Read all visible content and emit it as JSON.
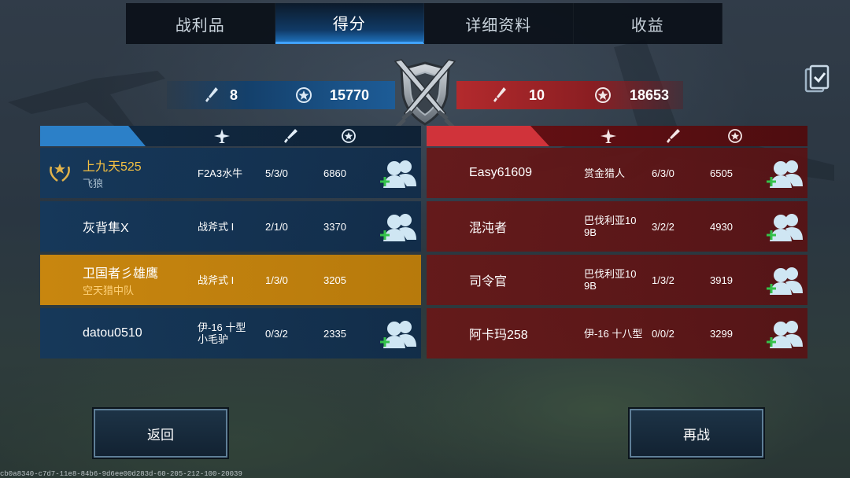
{
  "tabs": [
    {
      "label": "战利品",
      "active": false
    },
    {
      "label": "得分",
      "active": true
    },
    {
      "label": "详细资料",
      "active": false
    },
    {
      "label": "收益",
      "active": false
    }
  ],
  "score_header": {
    "blue_kills": "8",
    "blue_points": "15770",
    "red_kills": "10",
    "red_points": "18653"
  },
  "colors": {
    "blue_team": "#1d5c97",
    "red_team": "#b32a2d",
    "highlight": "#c8860f",
    "name_gold": "#f5c042",
    "add_friend_green": "#34c24a"
  },
  "blue_team": [
    {
      "name": "上九天525",
      "sub": "飞狼",
      "aircraft": "F2A3水牛",
      "kda": "5/3/0",
      "score": "6860",
      "add_friend": true,
      "badge": "laurel-badge-icon"
    },
    {
      "name": "灰背隼X",
      "sub": "",
      "aircraft": "战斧式 I",
      "kda": "2/1/0",
      "score": "3370",
      "add_friend": true
    },
    {
      "name": "卫国者彡雄鹰",
      "sub": "空天猎中队",
      "aircraft": "战斧式 I",
      "kda": "1/3/0",
      "score": "3205",
      "add_friend": false,
      "highlight": true
    },
    {
      "name": "datou0510",
      "sub": "",
      "aircraft": "伊-16 十型\n小毛驴",
      "kda": "0/3/2",
      "score": "2335",
      "add_friend": true
    }
  ],
  "red_team": [
    {
      "name": "Easy61609",
      "sub": "",
      "aircraft": "赏金猎人",
      "kda": "6/3/0",
      "score": "6505",
      "add_friend": true
    },
    {
      "name": "混沌者",
      "sub": "",
      "aircraft": "巴伐利亚10\n9B",
      "kda": "3/2/2",
      "score": "4930",
      "add_friend": true
    },
    {
      "name": "司令官",
      "sub": "",
      "aircraft": "巴伐利亚10\n9B",
      "kda": "1/3/2",
      "score": "3919",
      "add_friend": true
    },
    {
      "name": "阿卡玛258",
      "sub": "",
      "aircraft": "伊-16 十八型",
      "kda": "0/0/2",
      "score": "3299",
      "add_friend": true
    }
  ],
  "buttons": {
    "back": "返回",
    "again": "再战"
  },
  "footer_id": "cb0a8340-c7d7-11e8-84b6-9d6ee00d283d-60-205-212-100-20039"
}
